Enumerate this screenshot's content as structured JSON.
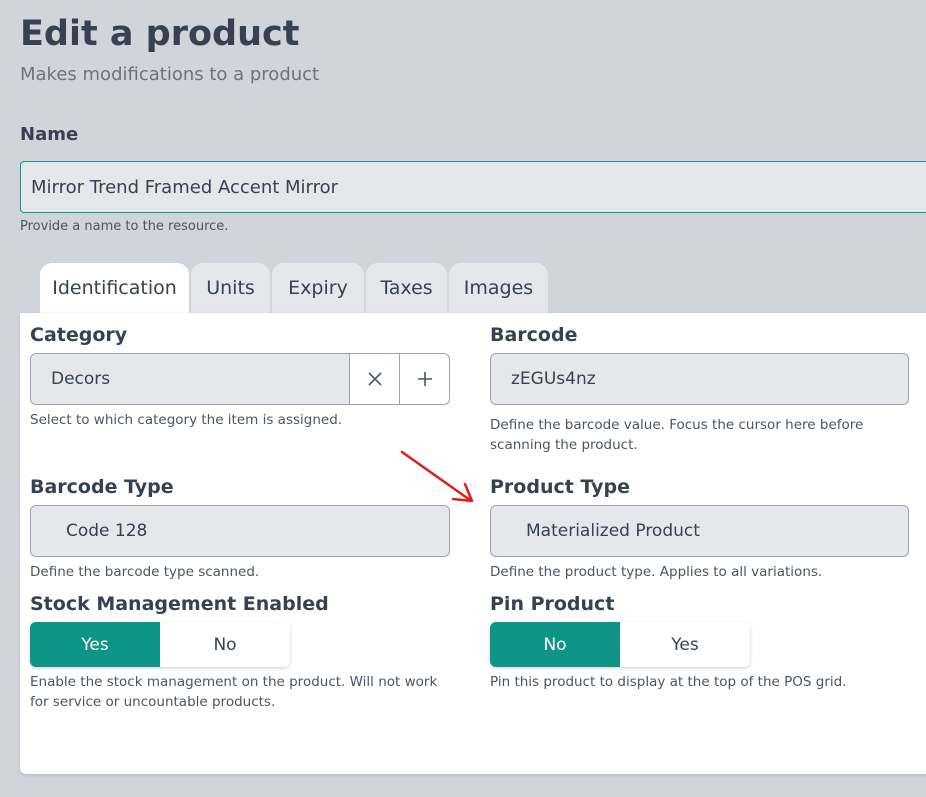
{
  "header": {
    "title": "Edit a product",
    "subtitle": "Makes modifications to a product"
  },
  "name_field": {
    "label": "Name",
    "value": "Mirror Trend Framed Accent Mirror",
    "help": "Provide a name to the resource."
  },
  "tabs": [
    {
      "label": "Identification",
      "active": true
    },
    {
      "label": "Units",
      "active": false
    },
    {
      "label": "Expiry",
      "active": false
    },
    {
      "label": "Taxes",
      "active": false
    },
    {
      "label": "Images",
      "active": false
    }
  ],
  "form": {
    "category": {
      "label": "Category",
      "value": "Decors",
      "help": "Select to which category the item is assigned.",
      "clear_icon": "close-icon",
      "add_icon": "plus-icon"
    },
    "barcode": {
      "label": "Barcode",
      "value": "zEGUs4nz",
      "help": "Define the barcode value. Focus the cursor here before scanning the product."
    },
    "barcode_type": {
      "label": "Barcode Type",
      "value": "Code 128",
      "help": "Define the barcode type scanned."
    },
    "product_type": {
      "label": "Product Type",
      "value": "Materialized Product",
      "help": "Define the product type. Applies to all variations."
    },
    "stock_management": {
      "label": "Stock Management Enabled",
      "options": [
        "Yes",
        "No"
      ],
      "selected": "Yes",
      "help": "Enable the stock management on the product. Will not work for service or uncountable products."
    },
    "pin_product": {
      "label": "Pin Product",
      "options": [
        "No",
        "Yes"
      ],
      "selected": "No",
      "help": "Pin this product to display at the top of the POS grid."
    }
  },
  "annotation": {
    "arrow_color": "#e11d1d"
  },
  "colors": {
    "accent": "#0f9488",
    "background": "#d1d5db",
    "panel": "#ffffff"
  }
}
